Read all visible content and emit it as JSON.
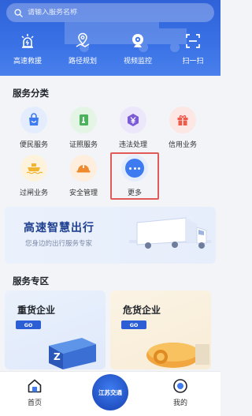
{
  "search": {
    "placeholder": "请输入服务名称"
  },
  "quick": [
    {
      "label": "高速救援",
      "icon": "rescue-icon"
    },
    {
      "label": "路径规划",
      "icon": "route-icon"
    },
    {
      "label": "视频监控",
      "icon": "camera-icon"
    },
    {
      "label": "扫一扫",
      "icon": "scan-icon"
    }
  ],
  "categories": {
    "title": "服务分类",
    "items": [
      {
        "label": "便民服务",
        "icon": "bag-icon",
        "color": "#3f7bf0",
        "bg": "#e3edfd"
      },
      {
        "label": "证照服务",
        "icon": "license-icon",
        "color": "#4cb35c",
        "bg": "#e4f5e6"
      },
      {
        "label": "违法处理",
        "icon": "yuan-icon",
        "color": "#7b5bd6",
        "bg": "#ece7fa"
      },
      {
        "label": "信用业务",
        "icon": "gift-icon",
        "color": "#f05a4a",
        "bg": "#fde7e4"
      },
      {
        "label": "过闸业务",
        "icon": "ship-icon",
        "color": "#f2b533",
        "bg": "#fdf3dc"
      },
      {
        "label": "安全管理",
        "icon": "helmet-icon",
        "color": "#f08a2e",
        "bg": "#fdeedd"
      },
      {
        "label": "更多",
        "icon": "more-icon",
        "color": "#3f7bf0",
        "bg": "#e3edfd"
      }
    ]
  },
  "banner": {
    "title": "高速智慧出行",
    "subtitle": "您身边的出行服务专家"
  },
  "zone": {
    "title": "服务专区",
    "cards": [
      {
        "title": "重货企业",
        "go": "GO"
      },
      {
        "title": "危货企业",
        "go": "GO"
      }
    ]
  },
  "tabbar": {
    "home": "首页",
    "center": "江苏交通",
    "mine": "我的"
  },
  "colors": {
    "primary": "#2f62d8",
    "highlight": "#e05a5a"
  }
}
